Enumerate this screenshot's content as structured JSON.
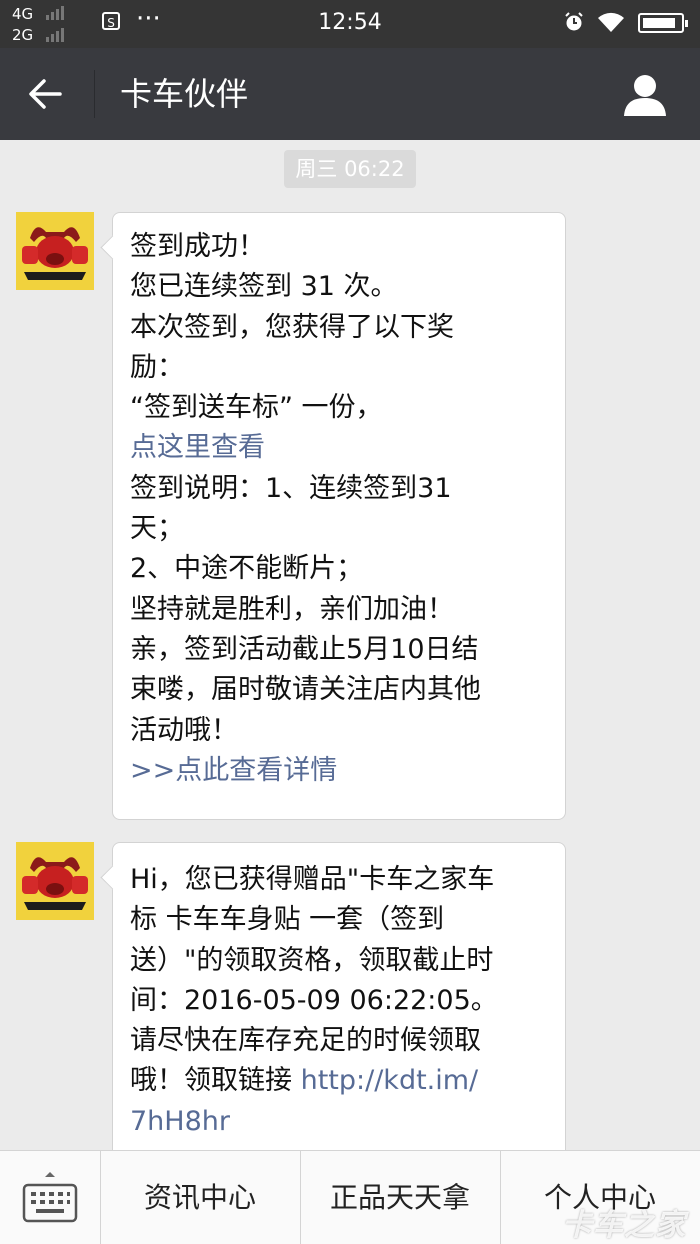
{
  "status_bar": {
    "network_1": "4G",
    "network_2": "2G",
    "time": "12:54",
    "battery_level": 0.9
  },
  "header": {
    "title": "卡车伙伴"
  },
  "chat": {
    "timestamp": "周三 06:22",
    "messages": [
      {
        "lines": [
          {
            "text": "签到成功！",
            "link": false
          },
          {
            "text": "您已连续签到 31 次。",
            "link": false
          },
          {
            "text": "本次签到，您获得了以下奖",
            "link": false
          },
          {
            "text": "励：",
            "link": false
          },
          {
            "text": "“签到送车标” 一份，",
            "link": false
          },
          {
            "text": "点这里查看",
            "link": true
          },
          {
            "text": "签到说明：1、连续签到31",
            "link": false
          },
          {
            "text": "天；",
            "link": false
          },
          {
            "text": "2、中途不能断片；",
            "link": false
          },
          {
            "text": "坚持就是胜利，亲们加油！",
            "link": false
          },
          {
            "text": "亲，签到活动截止5月10日结",
            "link": false
          },
          {
            "text": "束喽，届时敬请关注店内其他",
            "link": false
          },
          {
            "text": "活动哦！",
            "link": false
          },
          {
            "text": ">>点此查看详情",
            "link": true
          }
        ]
      },
      {
        "lines": [
          {
            "text": "Hi，您已获得赠品\"卡车之家车",
            "link": false
          },
          {
            "text": "标  卡车车身贴 一套（签到",
            "link": false
          },
          {
            "text": "送）\"的领取资格，领取截止时",
            "link": false
          },
          {
            "text": "间：2016-05-09 06:22:05。",
            "link": false
          },
          {
            "text": "请尽快在库存充足的时候领取",
            "link": false
          },
          {
            "text": "哦！领取链接 ",
            "link": false,
            "link_suffix": "http://kdt.im/"
          },
          {
            "text": "7hH8hr",
            "link": true
          }
        ]
      }
    ]
  },
  "menu": {
    "items": [
      "资讯中心",
      "正品天天拿",
      "个人中心"
    ]
  },
  "watermark": "卡车之家",
  "colors": {
    "header_bg": "#393a3f",
    "status_bg": "#353535",
    "chat_bg": "#ebebeb",
    "link": "#576b95"
  }
}
